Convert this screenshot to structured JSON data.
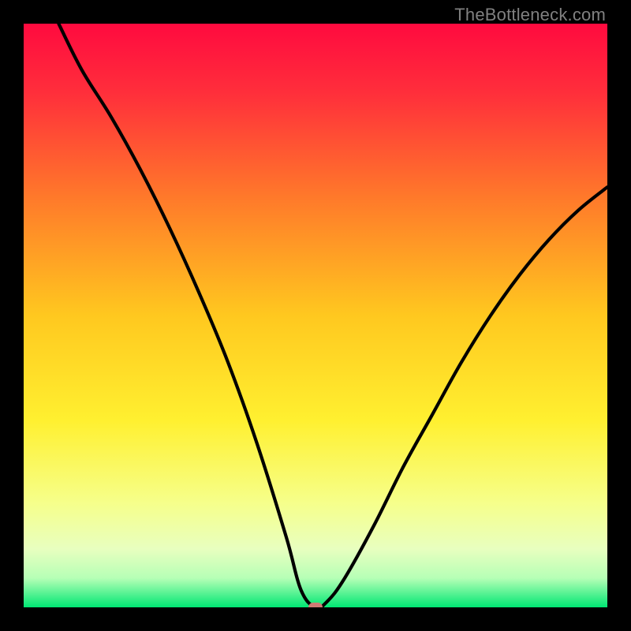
{
  "watermark": "TheBottleneck.com",
  "chart_data": {
    "type": "line",
    "title": "",
    "xlabel": "",
    "ylabel": "",
    "xlim": [
      0,
      100
    ],
    "ylim": [
      0,
      100
    ],
    "gradient_stops": [
      {
        "pos": 0.0,
        "color": "#ff0a3f"
      },
      {
        "pos": 0.12,
        "color": "#ff2f3b"
      },
      {
        "pos": 0.3,
        "color": "#ff7a2a"
      },
      {
        "pos": 0.5,
        "color": "#ffc81f"
      },
      {
        "pos": 0.68,
        "color": "#fff030"
      },
      {
        "pos": 0.82,
        "color": "#f6ff8a"
      },
      {
        "pos": 0.9,
        "color": "#e8ffbf"
      },
      {
        "pos": 0.95,
        "color": "#b6ffb6"
      },
      {
        "pos": 1.0,
        "color": "#00e773"
      }
    ],
    "series": [
      {
        "name": "bottleneck-curve",
        "x": [
          6,
          10,
          15,
          20,
          25,
          30,
          35,
          40,
          45,
          47.5,
          50,
          52,
          55,
          60,
          65,
          70,
          75,
          80,
          85,
          90,
          95,
          100
        ],
        "values": [
          100,
          92,
          84,
          75,
          65,
          54,
          42,
          28,
          12,
          3,
          0,
          1,
          5,
          14,
          24,
          33,
          42,
          50,
          57,
          63,
          68,
          72
        ]
      }
    ],
    "marker": {
      "x": 50,
      "y": 0,
      "color": "#cf7a74"
    }
  }
}
